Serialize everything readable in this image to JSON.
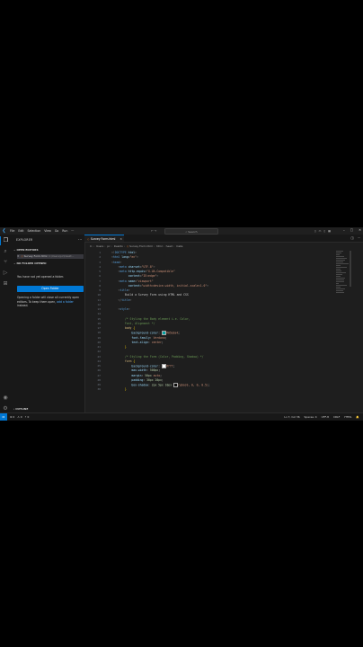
{
  "menu": [
    "File",
    "Edit",
    "Selection",
    "View",
    "Go",
    "Run"
  ],
  "titlebar": {
    "nav": "← →",
    "search": "Search"
  },
  "activity": [
    "files-icon",
    "search-icon",
    "source-control-icon",
    "run-debug-icon",
    "extensions-icon",
    "account-icon",
    "manage-icon"
  ],
  "sidebar": {
    "title": "EXPLORER",
    "open_editors": "OPEN EDITORS",
    "open_file_name": "Survey Form.html",
    "open_file_path": "C:\\Users\\pc\\Deskt...",
    "no_folder": "NO FOLDER OPENED",
    "no_folder_msg": "You have not yet opened a folder.",
    "open_folder_button": "Open Folder",
    "close_msg_1": "Opening a folder will close all currently open editors. To keep them open, ",
    "close_msg_link": "add a folder",
    "close_msg_2": " instead.",
    "outline": "OUTLINE",
    "timeline": "TIMELINE"
  },
  "tab": {
    "label": "Survey Form.html"
  },
  "breadcrumb": [
    "C:",
    "Users",
    "pc",
    "Deskto",
    "Survey Form.html",
    "html",
    "head",
    "meta"
  ],
  "code": {
    "line_numbers": [
      "1",
      "2",
      "3",
      "4",
      "5",
      "6",
      "7",
      "8",
      "9",
      "10",
      "11",
      "12",
      "13",
      "14",
      "15",
      "16",
      "17",
      "18",
      "19",
      "20",
      "21",
      "22",
      "23",
      "24",
      "25",
      "26",
      "27",
      "28",
      "29",
      "30"
    ],
    "title_text": "Build a Survey Form using HTML and CSS",
    "comment_body": "/* Styling the Body element i.e. Color,",
    "comment_body2": "Font, Alignment */",
    "comment_form": "/* Styling the Form (Color, Padding, Shadow) */"
  },
  "status": {
    "left": [
      "⊗ 0",
      "⚠ 0",
      "⚡ 0"
    ],
    "right": [
      "Ln 7, Col 36",
      "Spaces: 4",
      "UTF-8",
      "CRLF",
      "HTML",
      "🔔"
    ]
  }
}
